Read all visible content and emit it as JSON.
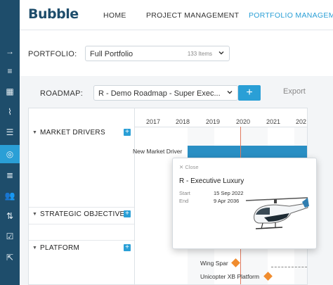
{
  "rail": {
    "items": [
      {
        "icon": "arrow-right-icon",
        "glyph": "→"
      },
      {
        "icon": "list-add-icon",
        "glyph": "≡"
      },
      {
        "icon": "dashboard-icon",
        "glyph": "▦"
      },
      {
        "icon": "line-chart-icon",
        "glyph": "⌇"
      },
      {
        "icon": "bullet-list-icon",
        "glyph": "☰"
      },
      {
        "icon": "compass-icon",
        "glyph": "◎"
      },
      {
        "icon": "lines-icon",
        "glyph": "≣"
      },
      {
        "icon": "people-icon",
        "glyph": "👥"
      },
      {
        "icon": "sort-icon",
        "glyph": "⇅"
      },
      {
        "icon": "checklist-icon",
        "glyph": "☑"
      },
      {
        "icon": "export-icon",
        "glyph": "⇱"
      }
    ],
    "active_index": 5
  },
  "header": {
    "logo": "Bubble",
    "nav": [
      "HOME",
      "PROJECT MANAGEMENT",
      "PORTFOLIO MANAGEM"
    ],
    "active_nav": 2
  },
  "portfolio": {
    "label": "PORTFOLIO:",
    "value": "Full Portfolio",
    "count": "133 Items"
  },
  "roadmap": {
    "label": "ROADMAP:",
    "value": "R - Demo Roadmap - Super Exec...",
    "add_label": "+",
    "export_label": "Export"
  },
  "gantt": {
    "years": [
      "2017",
      "2018",
      "2019",
      "2020",
      "2021",
      "202"
    ],
    "groups": [
      {
        "name": "MARKET DRIVERS"
      },
      {
        "name": "STRATEGIC OBJECTIVES"
      },
      {
        "name": "PLATFORM"
      }
    ],
    "bar_label": "New Market Driver",
    "milestones": [
      "Wing Spar",
      "Unicopter XB Platform"
    ]
  },
  "popup": {
    "close_label": "Close",
    "title": "R - Executive Luxury",
    "start_label": "Start",
    "start_value": "15 Sep 2022",
    "end_label": "End",
    "end_value": "9 Apr 2036"
  },
  "colors": {
    "rail": "#1e4d6b",
    "accent": "#2a9fd6",
    "bar": "#2a8fc4",
    "milestone": "#f08c2e",
    "today_line": "#e07a5f"
  }
}
